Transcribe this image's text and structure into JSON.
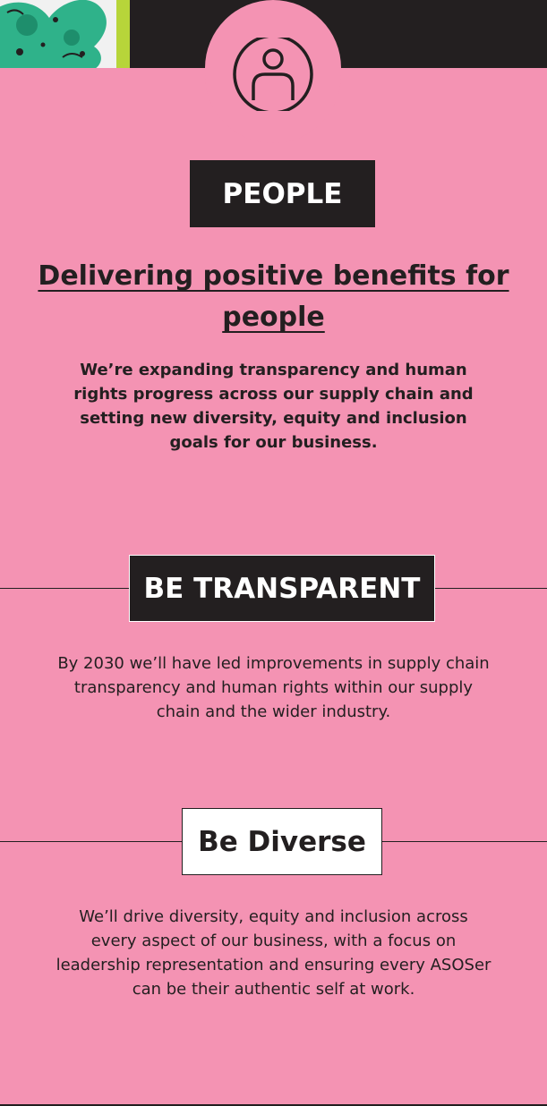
{
  "colors": {
    "background": "#f493b3",
    "dark": "#231f20",
    "light": "#ffffff",
    "accent_green": "#b7d53a",
    "art_teal": "#2fb28a"
  },
  "header": {
    "icon": "person-icon",
    "artwork": "artwork-thumbnail"
  },
  "section": {
    "title": "PEOPLE",
    "headline": "Delivering positive benefits for people",
    "intro": "We’re expanding transparency and human rights progress across our supply chain and setting new diversity, equity and inclusion goals for our business."
  },
  "goals": [
    {
      "title": "BE TRANSPARENT",
      "text": "By 2030 we’ll have led improvements in supply chain transparency and human rights within our supply chain and the wider industry."
    },
    {
      "title": "Be Diverse",
      "text": "We’ll drive diversity, equity and inclusion across every aspect of our business, with a focus on leadership representation and ensuring every ASOSer can be their authentic self at work."
    }
  ]
}
